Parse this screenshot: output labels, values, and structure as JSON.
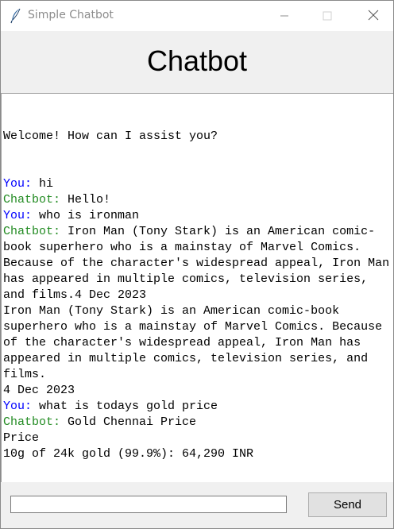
{
  "window": {
    "title": "Simple Chatbot",
    "icons": [
      "feather-icon",
      "minimize-icon",
      "maximize-icon",
      "close-icon"
    ]
  },
  "header": {
    "title": "Chatbot"
  },
  "chat": {
    "welcome": "Welcome! How can I assist you?",
    "you_label": "You:",
    "bot_label": "Chatbot:",
    "messages": [
      {
        "speaker": "you",
        "text": " hi"
      },
      {
        "speaker": "bot",
        "text": " Hello!"
      },
      {
        "speaker": "you",
        "text": " who is ironman"
      },
      {
        "speaker": "bot",
        "text": " Iron Man (Tony Stark) is an American comic-book superhero who is a mainstay of Marvel Comics. Because of the character's widespread appeal, Iron Man has appeared in multiple comics, television series, and films.4 Dec 2023\nIron Man (Tony Stark) is an American comic-book superhero who is a mainstay of Marvel Comics. Because of the character's widespread appeal, Iron Man has appeared in multiple comics, television series, and films.\n4 Dec 2023"
      },
      {
        "speaker": "you",
        "text": " what is todays gold price"
      },
      {
        "speaker": "bot",
        "text": " Gold Chennai Price\nPrice\n10g of 24k gold (99.9%): 64,290 INR"
      }
    ]
  },
  "input": {
    "value": "",
    "placeholder": ""
  },
  "buttons": {
    "send_label": "Send"
  },
  "colors": {
    "you": "#0000ff",
    "bot": "#228b22",
    "background": "#f0f0f0"
  }
}
